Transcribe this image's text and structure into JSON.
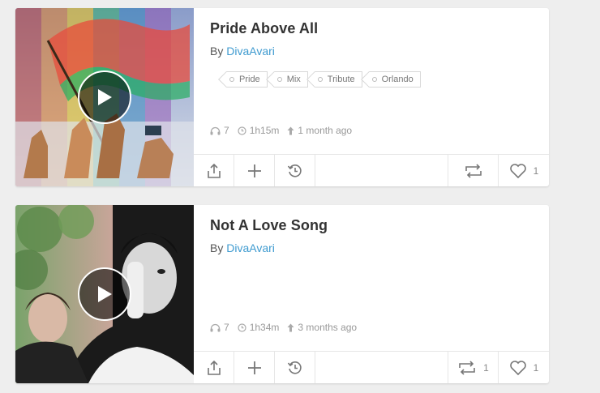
{
  "feed": [
    {
      "title": "Pride Above All",
      "by_label": "By",
      "author": "DivaAvari",
      "tags": [
        "Pride",
        "Mix",
        "Tribute",
        "Orlando"
      ],
      "listens": "7",
      "duration": "1h15m",
      "uploaded": "1 month ago",
      "repost_count": "",
      "like_count": "1",
      "thumbnail": "rainbow-flag-artwork"
    },
    {
      "title": "Not A Love Song",
      "by_label": "By",
      "author": "DivaAvari",
      "tags": [],
      "listens": "7",
      "duration": "1h34m",
      "uploaded": "3 months ago",
      "repost_count": "1",
      "like_count": "1",
      "thumbnail": "portrait-collage-artwork"
    }
  ],
  "icons": {
    "play": "play-icon",
    "listens": "headphones-icon",
    "duration": "clock-icon",
    "uploaded": "upload-arrow-icon",
    "share": "share-icon",
    "add": "plus-icon",
    "listen_later": "history-icon",
    "repost": "repost-icon",
    "like": "heart-icon"
  },
  "colors": {
    "link": "#3f9bd0",
    "title": "#333333",
    "meta": "#999999",
    "background": "#eeeeee"
  }
}
